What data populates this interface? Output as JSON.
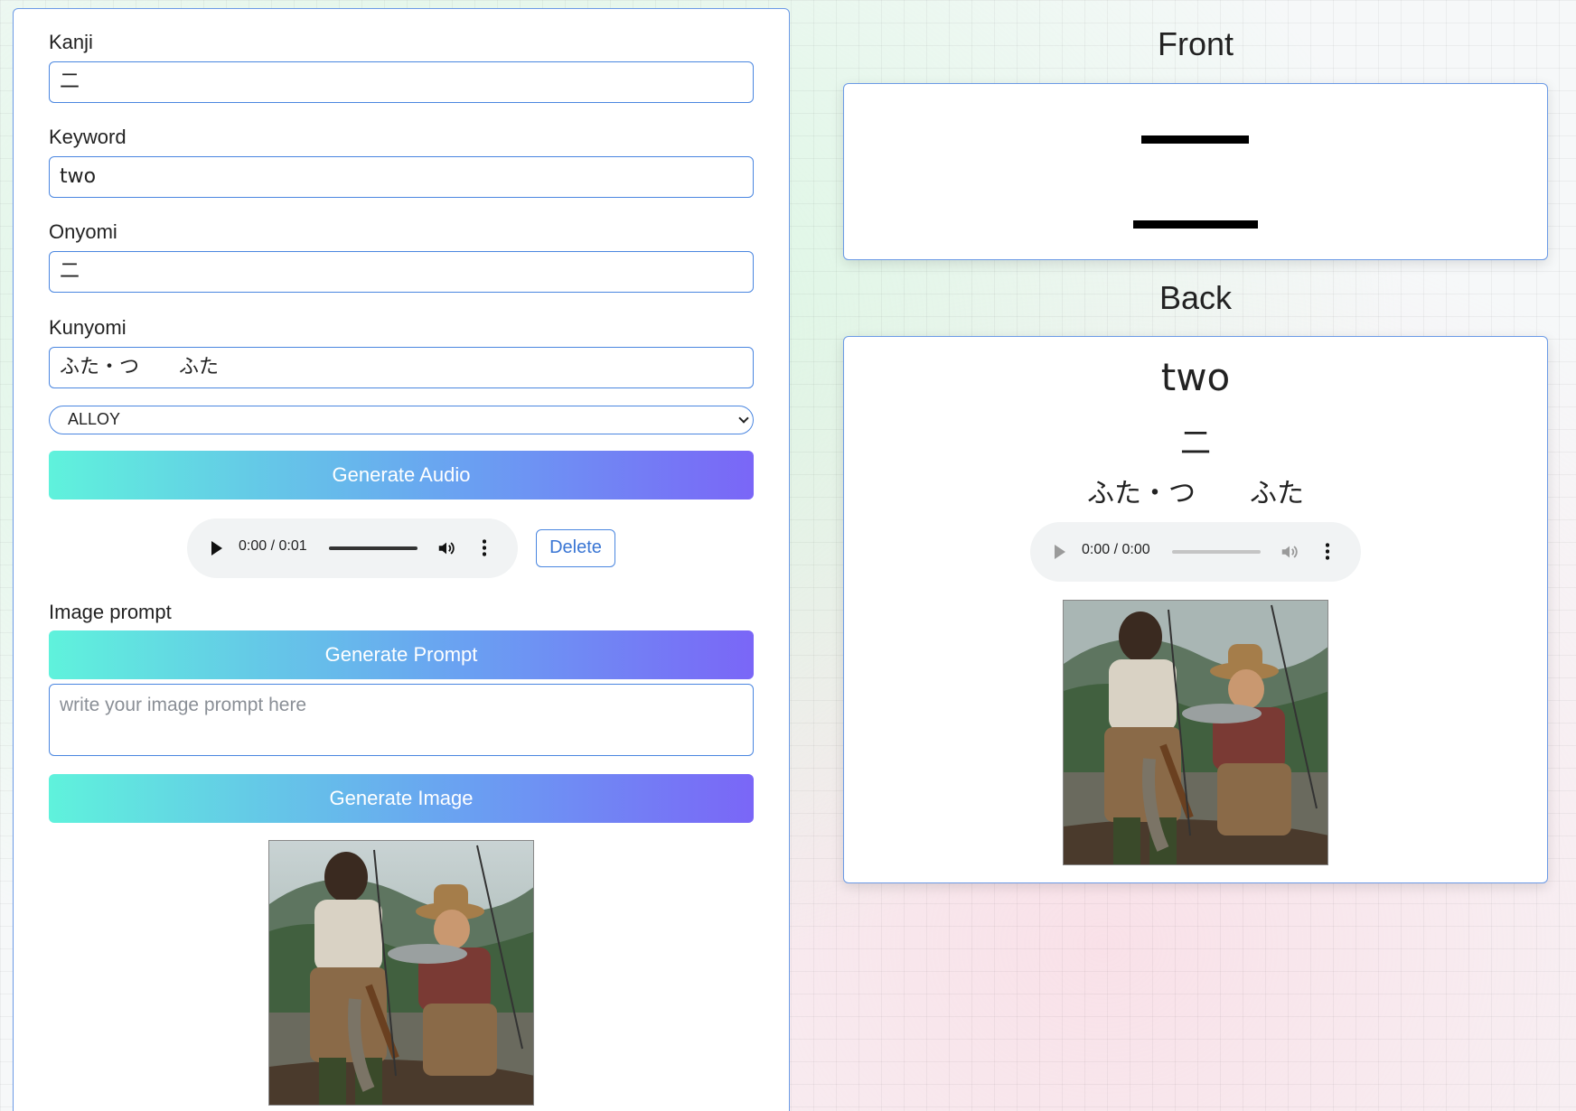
{
  "editor": {
    "kanji": {
      "label": "Kanji",
      "value": "二"
    },
    "keyword": {
      "label": "Keyword",
      "value": "two"
    },
    "onyomi": {
      "label": "Onyomi",
      "value": "二"
    },
    "kunyomi": {
      "label": "Kunyomi",
      "value": "ふた・つ　　ふた"
    },
    "voice_select": {
      "selected": "ALLOY"
    },
    "generate_audio_label": "Generate Audio",
    "audio_player": {
      "time": "0:00 / 0:01"
    },
    "delete_label": "Delete",
    "image_prompt_label": "Image prompt",
    "generate_prompt_label": "Generate Prompt",
    "prompt_placeholder": "write your image prompt here",
    "generate_image_label": "Generate Image"
  },
  "preview": {
    "front_heading": "Front",
    "back_heading": "Back",
    "back": {
      "keyword": "two",
      "onyomi": "二",
      "kunyomi": "ふた・つ　　ふた",
      "audio_time": "0:00 / 0:00"
    }
  },
  "colors": {
    "accent": "#4a86e0",
    "gradient_start": "#5ff2dc",
    "gradient_end": "#7a66f7"
  }
}
